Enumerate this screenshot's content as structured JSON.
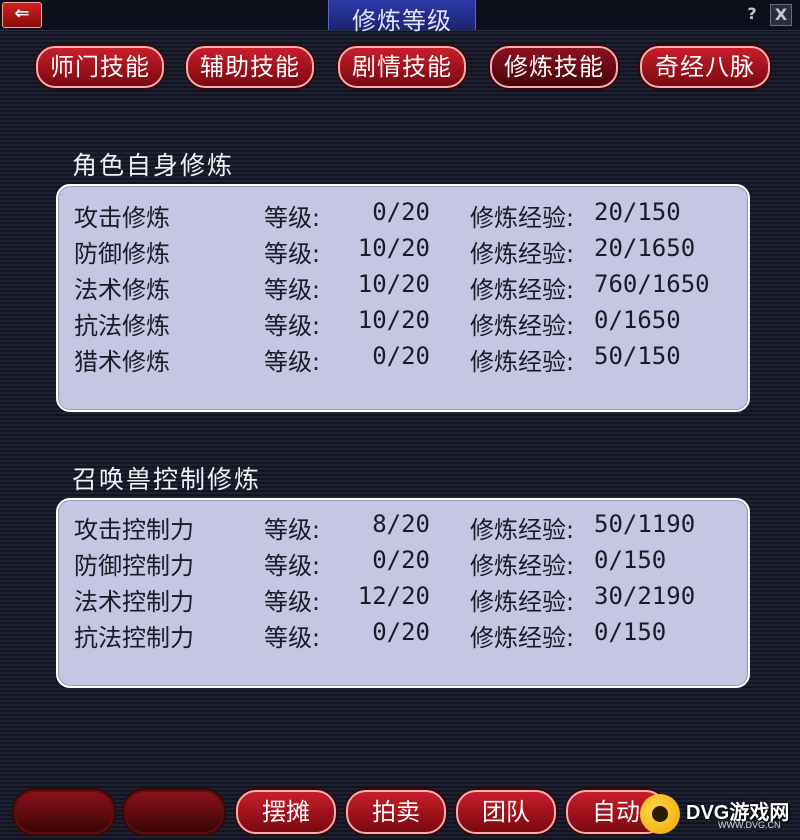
{
  "window": {
    "title": "修炼等级",
    "back_label": "⇐",
    "help_label": "?",
    "close_label": "X"
  },
  "tabs": [
    {
      "label": "师门技能",
      "active": false
    },
    {
      "label": "辅助技能",
      "active": false
    },
    {
      "label": "剧情技能",
      "active": false
    },
    {
      "label": "修炼技能",
      "active": true
    },
    {
      "label": "奇经八脉",
      "active": false
    }
  ],
  "character_training": {
    "title": "角色自身修炼",
    "level_label": "等级:",
    "exp_label": "修炼经验:",
    "rows": [
      {
        "name": "攻击修炼",
        "level": "0/20",
        "exp": "20/150"
      },
      {
        "name": "防御修炼",
        "level": "10/20",
        "exp": "20/1650"
      },
      {
        "name": "法术修炼",
        "level": "10/20",
        "exp": "760/1650"
      },
      {
        "name": "抗法修炼",
        "level": "10/20",
        "exp": "0/1650"
      },
      {
        "name": "猎术修炼",
        "level": "0/20",
        "exp": "50/150"
      }
    ]
  },
  "pet_control": {
    "title": "召唤兽控制修炼",
    "level_label": "等级:",
    "exp_label": "修炼经验:",
    "rows": [
      {
        "name": "攻击控制力",
        "level": "8/20",
        "exp": "50/1190"
      },
      {
        "name": "防御控制力",
        "level": "0/20",
        "exp": "0/150"
      },
      {
        "name": "法术控制力",
        "level": "12/20",
        "exp": "30/2190"
      },
      {
        "name": "抗法控制力",
        "level": "0/20",
        "exp": "0/150"
      }
    ]
  },
  "bottom_bar": {
    "buttons": [
      "摆摊",
      "拍卖",
      "团队",
      "自动"
    ]
  },
  "watermark": {
    "text": "DVG游戏网",
    "url": "WWW.DVG.CN"
  },
  "colors": {
    "tab_red": "#c81e2a",
    "panel_bg": "#c7c6e2",
    "title_blue": "#2d3aa8"
  }
}
